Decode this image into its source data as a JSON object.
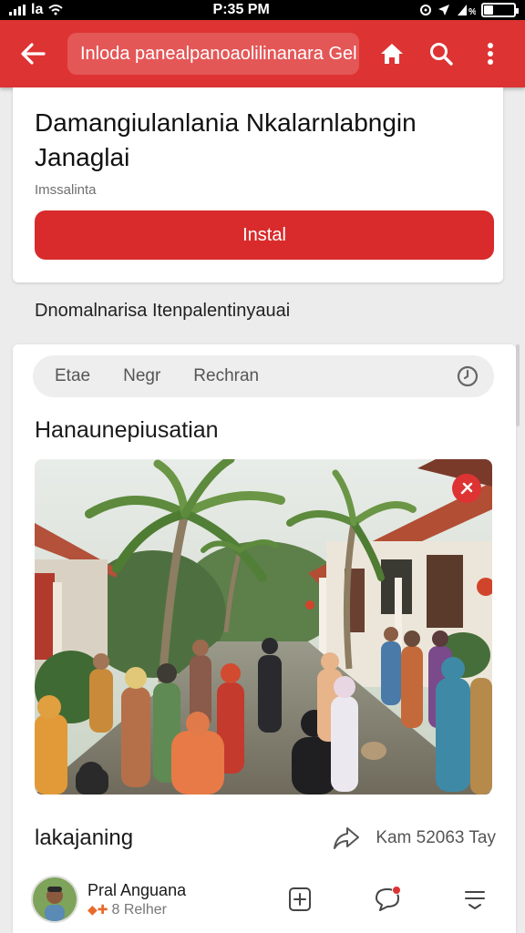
{
  "status_bar": {
    "carrier": "la",
    "time": "P:35 PM"
  },
  "app_bar": {
    "title": "Inloda panealpanoaolilinanara Gel",
    "icons": [
      "back-arrow-icon",
      "home-icon",
      "search-icon",
      "more-vertical-icon"
    ],
    "color": "#de3333"
  },
  "app_card": {
    "title": "Damangiulanlania Nkalarnlabngin Janaglai",
    "subtitle": "Imssalinta",
    "install_label": "Instal",
    "install_color": "#d92b2b"
  },
  "section_label": "Dnomalnarisa Itenpalentinyauai",
  "feed": {
    "chips": [
      "Etae",
      "Negr",
      "Rechran"
    ],
    "heading": "Hanaunepiusatian",
    "image_description_icon": "community-gathering-photo",
    "post_title": "lakajaning",
    "post_stats": "Kam 52063 Tay",
    "author": {
      "name": "Pral Anguana",
      "meta": "8 Relher"
    },
    "actions": [
      "add-post-icon",
      "chat-notification-icon",
      "menu-lines-icon"
    ]
  }
}
